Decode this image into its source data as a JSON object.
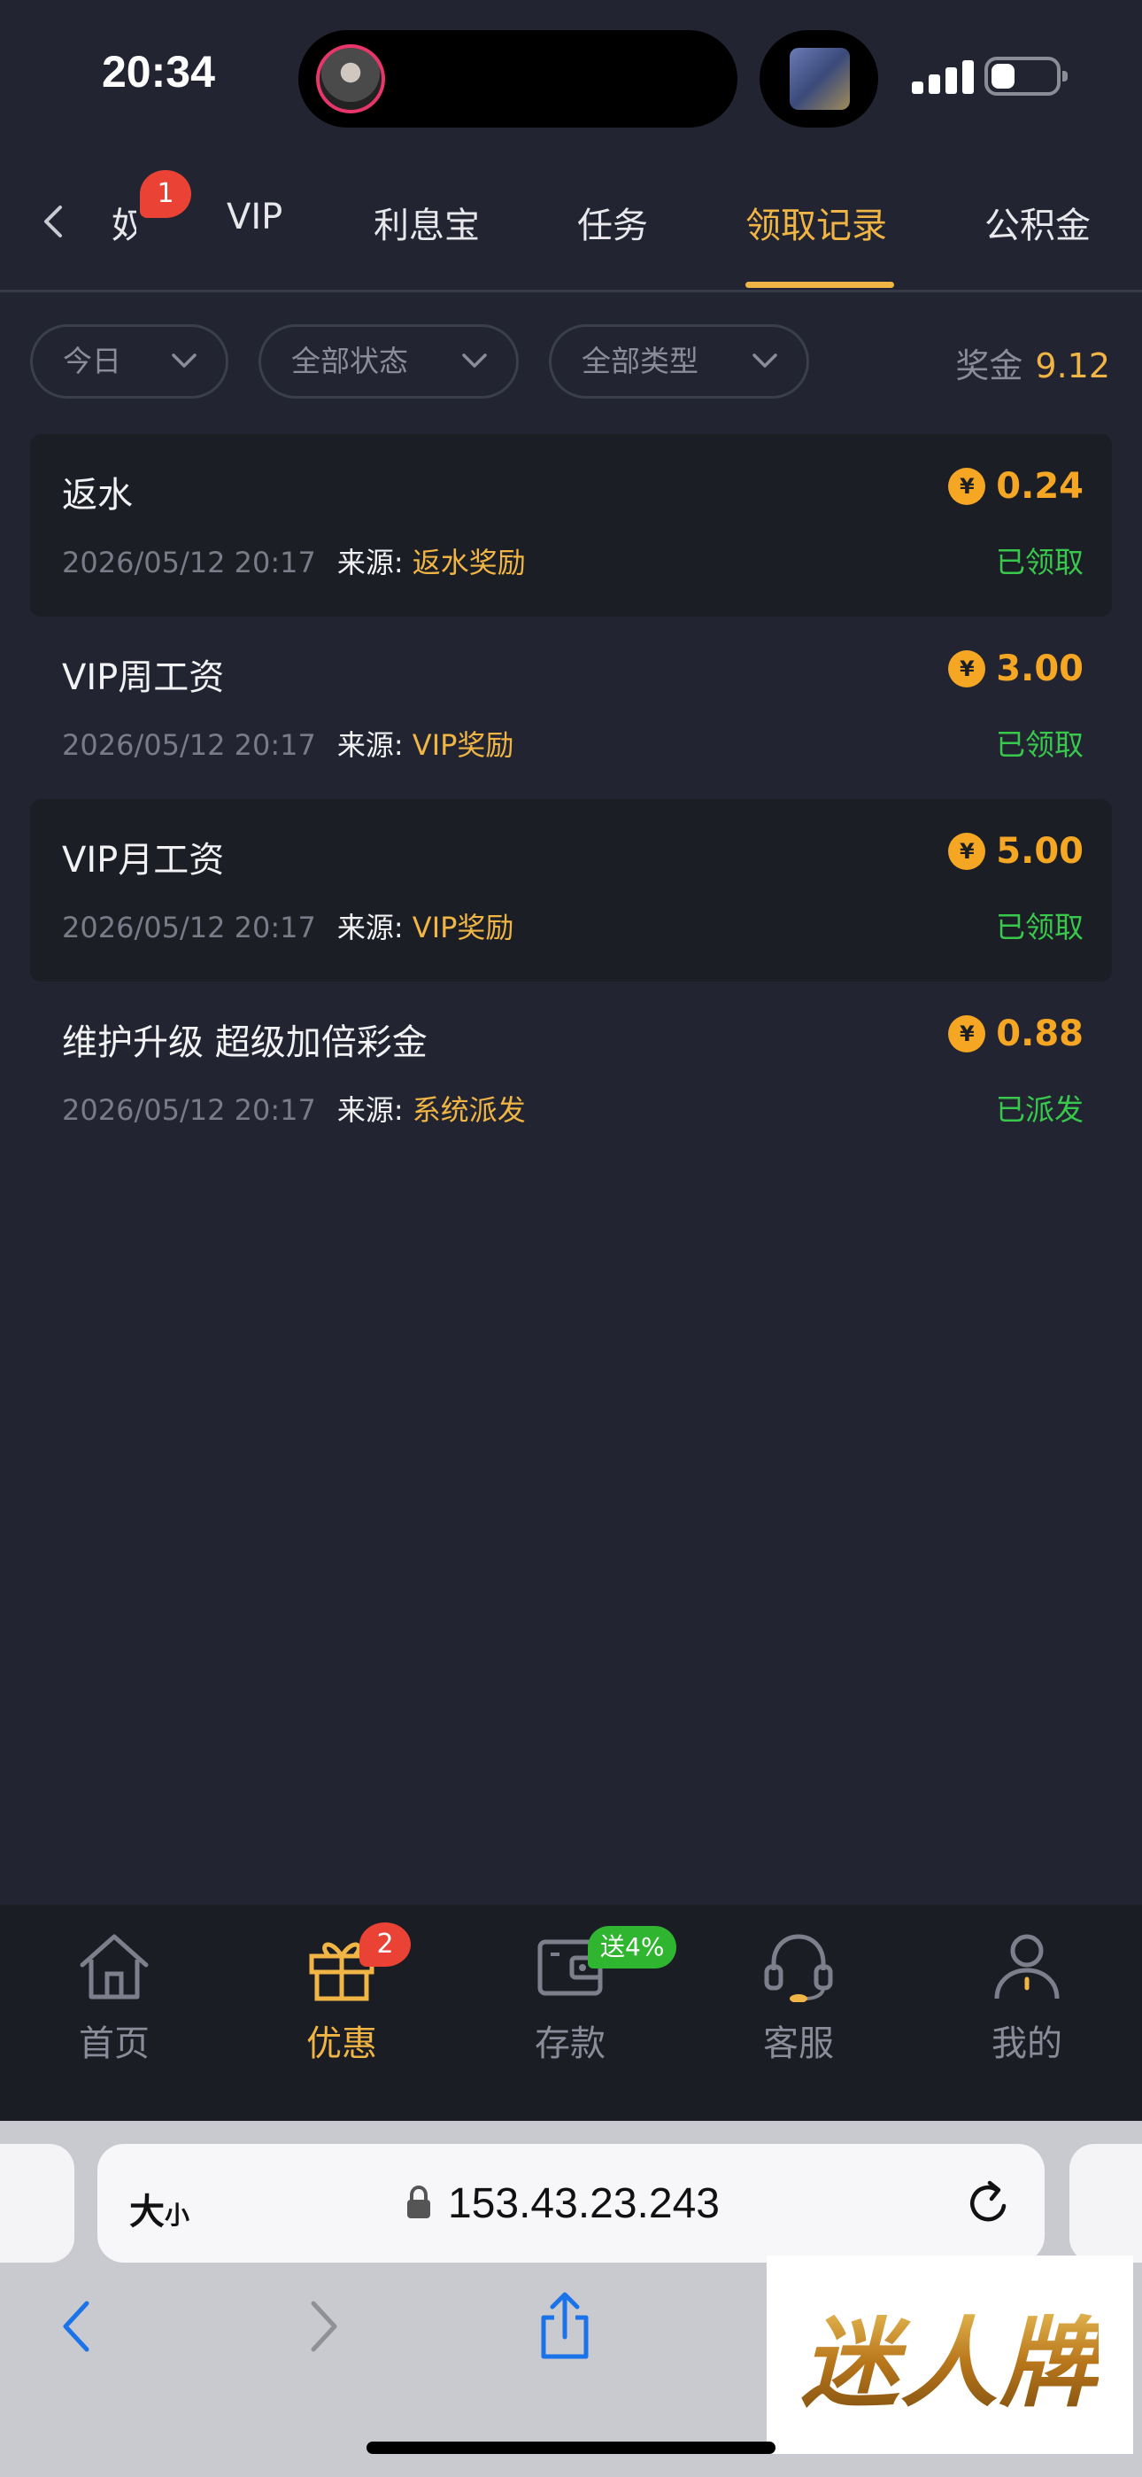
{
  "status_bar": {
    "time": "20:34"
  },
  "tabs": {
    "items": [
      {
        "label": "奴",
        "badge": "1"
      },
      {
        "label": "VIP"
      },
      {
        "label": "利息宝"
      },
      {
        "label": "任务"
      },
      {
        "label": "领取记录",
        "active": true
      },
      {
        "label": "公积金"
      }
    ]
  },
  "filters": {
    "date": "今日",
    "status": "全部状态",
    "type": "全部类型",
    "bonus_label": "奖金",
    "bonus_value": "9.12"
  },
  "records": [
    {
      "title": "返水",
      "time": "2026/05/12 20:17",
      "source_label": "来源:",
      "source": "返水奖励",
      "amount": "0.24",
      "status": "已领取"
    },
    {
      "title": "VIP周工资",
      "time": "2026/05/12 20:17",
      "source_label": "来源:",
      "source": "VIP奖励",
      "amount": "3.00",
      "status": "已领取"
    },
    {
      "title": "VIP月工资",
      "time": "2026/05/12 20:17",
      "source_label": "来源:",
      "source": "VIP奖励",
      "amount": "5.00",
      "status": "已领取"
    },
    {
      "title": "维护升级 超级加倍彩金",
      "time": "2026/05/12 20:17",
      "source_label": "来源:",
      "source": "系统派发",
      "amount": "0.88",
      "status": "已派发"
    }
  ],
  "coin_symbol": "¥",
  "bottom_nav": {
    "home": "首页",
    "promo": "优惠",
    "promo_badge": "2",
    "deposit": "存款",
    "deposit_promo": "送4%",
    "service": "客服",
    "mine": "我的"
  },
  "browser": {
    "text_size_big": "大",
    "text_size_small": "小",
    "url": "153.43.23.243"
  },
  "watermark": "迷人牌",
  "colors": {
    "background": "#222531",
    "accent": "#f0b544",
    "amount": "#f5a623",
    "success": "#38c94c",
    "badge": "#ea4335"
  }
}
